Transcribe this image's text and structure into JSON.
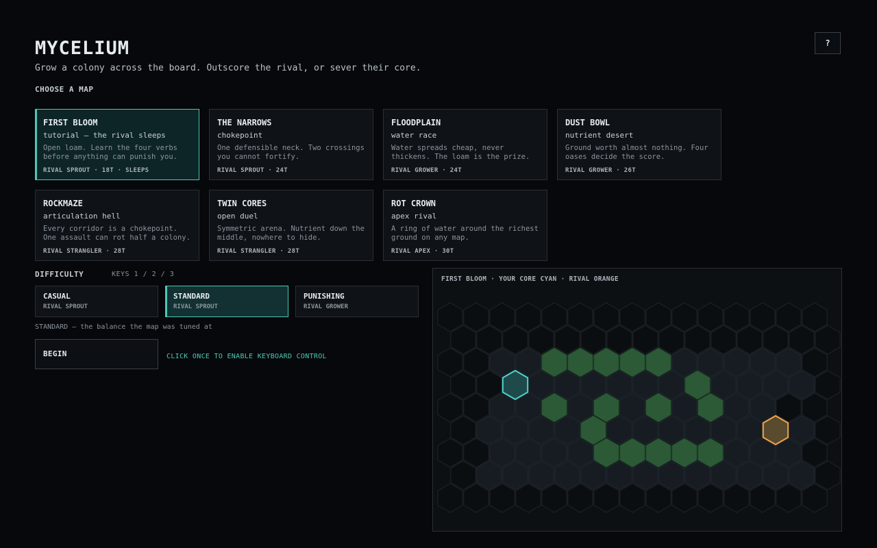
{
  "header": {
    "title": "MYCELIUM",
    "subtitle": "Grow a colony across the board. Outscore the rival, or sever their core.",
    "help_label": "?"
  },
  "maps_section": {
    "label": "CHOOSE A MAP",
    "selected": 0,
    "cards": [
      {
        "name": "FIRST BLOOM",
        "tag": "tutorial — the rival sleeps",
        "desc": "Open loam. Learn the four verbs before anything can punish you.",
        "meta": "RIVAL SPROUT · 18T · SLEEPS"
      },
      {
        "name": "THE NARROWS",
        "tag": "chokepoint",
        "desc": "One defensible neck. Two crossings you cannot fortify.",
        "meta": "RIVAL SPROUT · 24T"
      },
      {
        "name": "FLOODPLAIN",
        "tag": "water race",
        "desc": "Water spreads cheap, never thickens. The loam is the prize.",
        "meta": "RIVAL GROWER · 24T"
      },
      {
        "name": "DUST BOWL",
        "tag": "nutrient desert",
        "desc": "Ground worth almost nothing. Four oases decide the score.",
        "meta": "RIVAL GROWER · 26T"
      },
      {
        "name": "ROCKMAZE",
        "tag": "articulation hell",
        "desc": "Every corridor is a chokepoint. One assault can rot half a colony.",
        "meta": "RIVAL STRANGLER · 28T"
      },
      {
        "name": "TWIN CORES",
        "tag": "open duel",
        "desc": "Symmetric arena. Nutrient down the middle, nowhere to hide.",
        "meta": "RIVAL STRANGLER · 28T"
      },
      {
        "name": "ROT CROWN",
        "tag": "apex rival",
        "desc": "A ring of water around the richest ground on any map.",
        "meta": "RIVAL APEX · 30T"
      }
    ]
  },
  "difficulty": {
    "label": "DIFFICULTY",
    "keys": "KEYS 1 / 2 / 3",
    "selected": 1,
    "options": [
      {
        "name": "CASUAL",
        "sub": "RIVAL SPROUT"
      },
      {
        "name": "STANDARD",
        "sub": "RIVAL SPROUT"
      },
      {
        "name": "PUNISHING",
        "sub": "RIVAL GROWER"
      }
    ],
    "description": "STANDARD — the balance the map was tuned at"
  },
  "actions": {
    "begin_label": "BEGIN",
    "hint": "CLICK ONCE TO ENABLE KEYBOARD CONTROL"
  },
  "board": {
    "caption": "FIRST BLOOM · YOUR CORE CYAN · RIVAL ORANGE",
    "colors": {
      "empty_fill": "#0b0e11",
      "empty_stroke": "#20252b",
      "loam_fill": "#161c22",
      "loam_stroke": "#232a31",
      "nutrient_fill": "#2c5a36",
      "nutrient_stroke": "#244a2d",
      "player_core_fill": "#1f4a4c",
      "player_core_stroke": "#4fd3c8",
      "rival_core_fill": "#5a4a2e",
      "rival_core_stroke": "#f0a64a"
    },
    "rows": [
      "................",
      "...............",
      "..LLGGGGGLLLLL..",
      "..PLLLLLLGLLLL.",
      "..LLGLGLGLGLL...",
      ".LLLLGLLLLLLRL.",
      "..LLLLGGGGGLLL..",
      ".LLLLLLLLLLLLL.",
      "................"
    ],
    "legend": {
      ".": "empty",
      "L": "loam",
      "G": "nutrient",
      "P": "player-core",
      "R": "rival-core"
    }
  }
}
